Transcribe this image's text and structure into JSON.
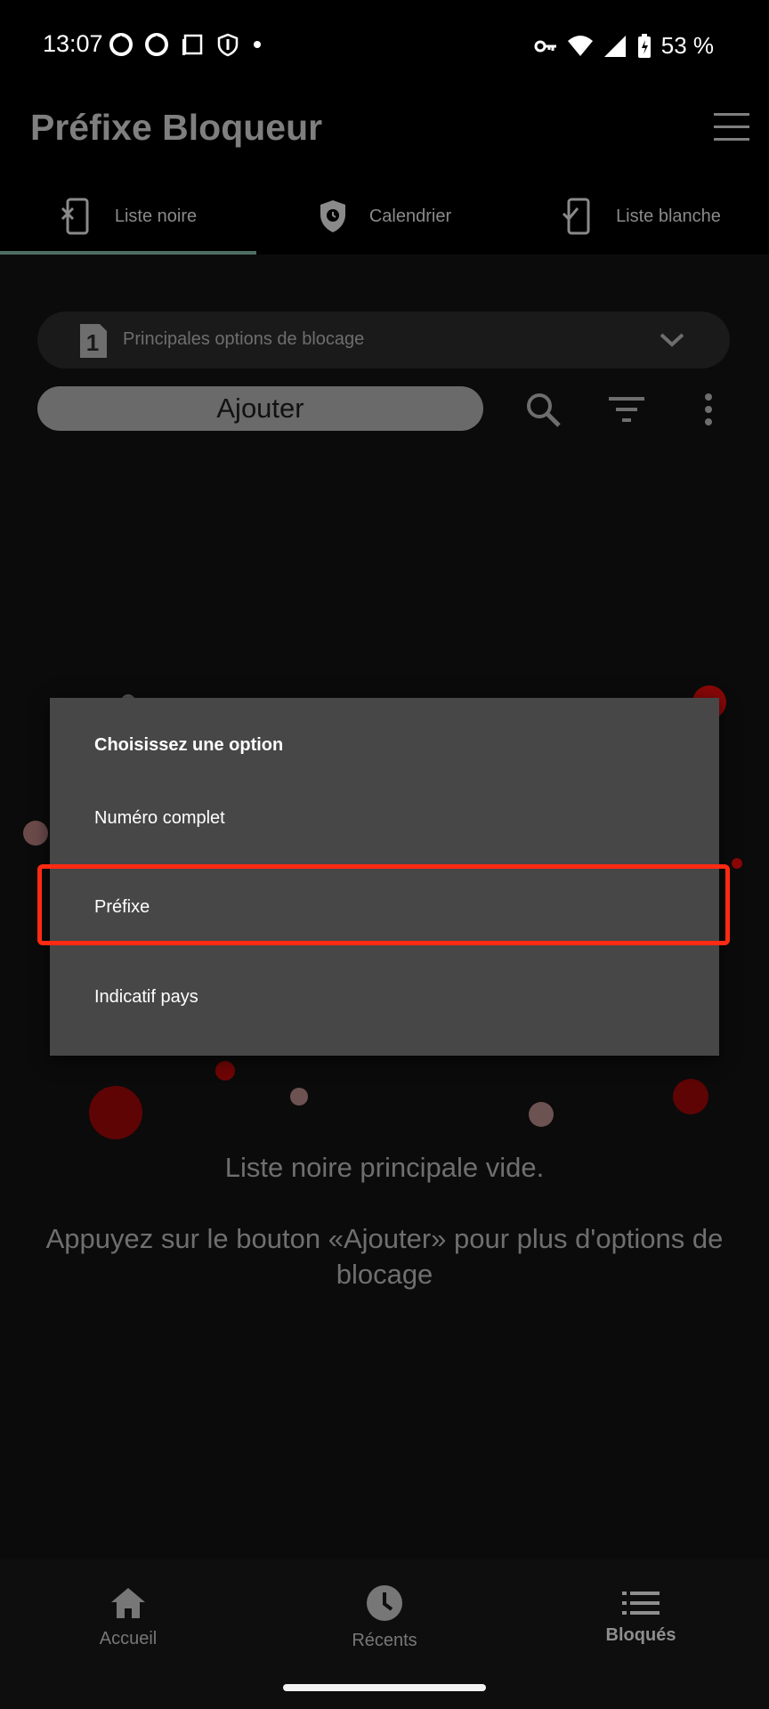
{
  "status_bar": {
    "time": "13:07",
    "battery": "53 %",
    "icons_left": [
      "sync-icon",
      "sync-icon",
      "square-icon",
      "shield-icon",
      "dot-icon"
    ],
    "icons_right": [
      "key-icon",
      "wifi-icon",
      "signal-icon",
      "battery-icon"
    ]
  },
  "app": {
    "title": "Préfixe Bloqueur"
  },
  "tabs": [
    {
      "label": "Liste noire",
      "icon": "phone-x-icon",
      "active": true
    },
    {
      "label": "Calendrier",
      "icon": "shield-clock-icon",
      "active": false
    },
    {
      "label": "Liste blanche",
      "icon": "phone-check-icon",
      "active": false
    }
  ],
  "list_selector": {
    "badge": "1",
    "label": "Principales options de blocage"
  },
  "toolbar": {
    "add_label": "Ajouter"
  },
  "empty_state": {
    "title": "Liste noire principale vide.",
    "subtitle": "Appuyez sur le bouton «Ajouter» pour plus d'options de blocage"
  },
  "dialog": {
    "title": "Choisissez une option",
    "options": [
      "Numéro complet",
      "Préfixe",
      "Indicatif pays"
    ],
    "highlighted_index": 1
  },
  "bottom_nav": [
    {
      "label": "Accueil",
      "icon": "home-icon",
      "active": false
    },
    {
      "label": "Récents",
      "icon": "clock-icon",
      "active": false
    },
    {
      "label": "Bloqués",
      "icon": "list-icon",
      "active": true
    }
  ],
  "colors": {
    "highlight": "#ff2a12",
    "tab_indicator": "#4e6e64",
    "dialog_bg": "#474747",
    "dot_red": "#8a0707"
  }
}
